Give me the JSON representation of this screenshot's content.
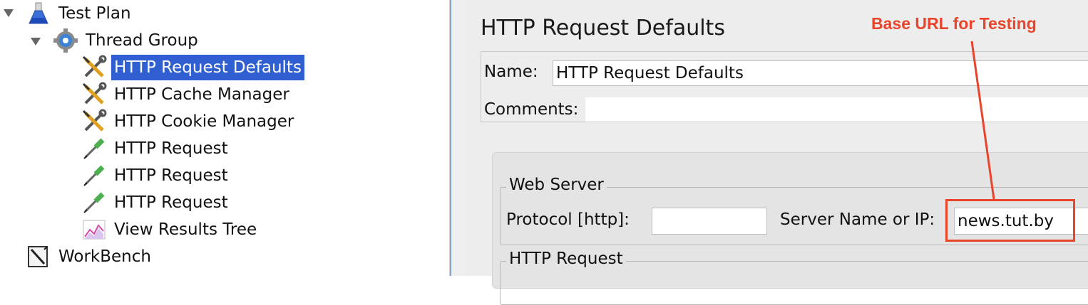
{
  "tree": {
    "test_plan": "Test Plan",
    "thread_group": "Thread Group",
    "items": [
      {
        "label": "HTTP Request Defaults",
        "icon": "wrench-screwdriver-icon",
        "selected": true
      },
      {
        "label": "HTTP Cache Manager",
        "icon": "wrench-screwdriver-icon",
        "selected": false
      },
      {
        "label": "HTTP Cookie Manager",
        "icon": "wrench-screwdriver-icon",
        "selected": false
      },
      {
        "label": "HTTP Request",
        "icon": "pipette-icon",
        "selected": false
      },
      {
        "label": "HTTP Request",
        "icon": "pipette-icon",
        "selected": false
      },
      {
        "label": "HTTP Request",
        "icon": "pipette-icon",
        "selected": false
      },
      {
        "label": "View Results Tree",
        "icon": "chart-icon",
        "selected": false
      }
    ],
    "workbench": "WorkBench"
  },
  "panel": {
    "title": "HTTP Request Defaults",
    "name_label": "Name:",
    "name_value": "HTTP Request Defaults",
    "comments_label": "Comments:",
    "comments_value": "",
    "web_server_legend": "Web Server",
    "protocol_label": "Protocol [http]:",
    "protocol_value": "",
    "server_label": "Server Name or IP:",
    "server_value": "news.tut.by",
    "http_request_legend": "HTTP Request"
  },
  "annotation": {
    "text": "Base URL for Testing",
    "color": "#e8452c"
  },
  "colors": {
    "selection": "#2f5fd1",
    "panel_bg": "#ededed"
  }
}
